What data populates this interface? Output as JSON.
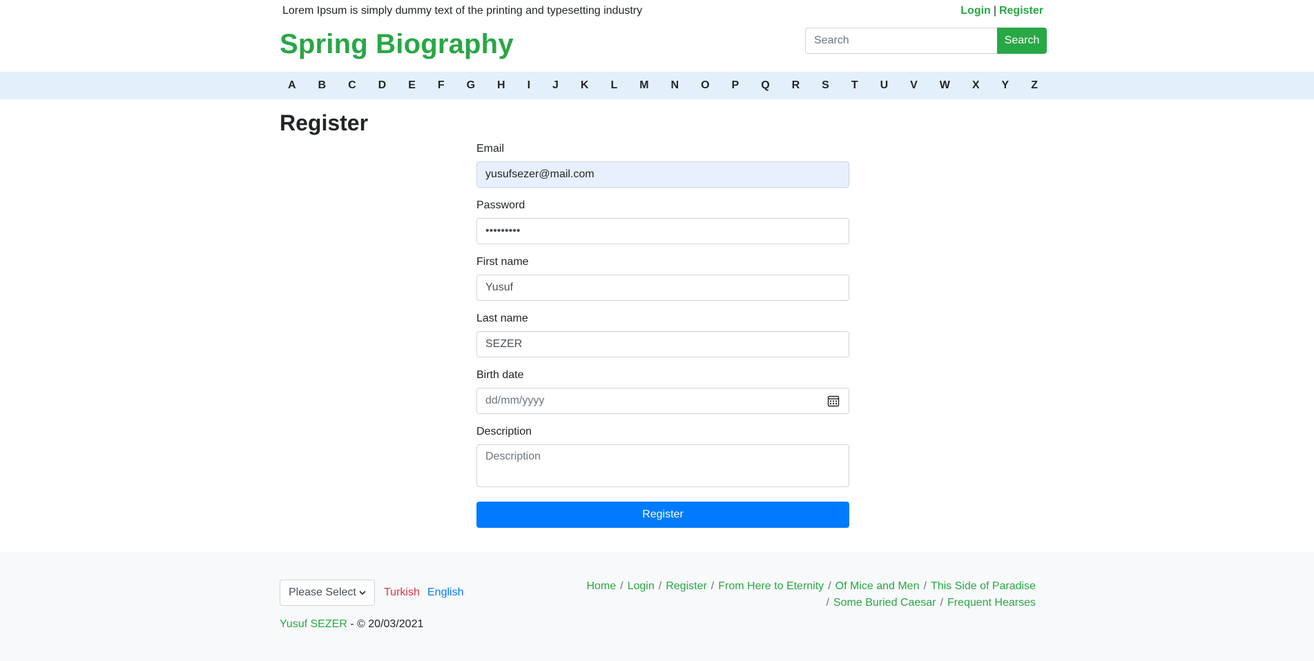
{
  "topbar": {
    "tagline": "Lorem Ipsum is simply dummy text of the printing and typesetting industry",
    "login": "Login",
    "separator": "|",
    "register": "Register"
  },
  "brand": "Spring Biography",
  "search": {
    "placeholder": "Search",
    "button": "Search"
  },
  "alphabet": [
    "A",
    "B",
    "C",
    "D",
    "E",
    "F",
    "G",
    "H",
    "I",
    "J",
    "K",
    "L",
    "M",
    "N",
    "O",
    "P",
    "Q",
    "R",
    "S",
    "T",
    "U",
    "V",
    "W",
    "X",
    "Y",
    "Z"
  ],
  "page_title": "Register",
  "form": {
    "email": {
      "label": "Email",
      "value": "yusufsezer@mail.com"
    },
    "password": {
      "label": "Password",
      "value": "•••••••••"
    },
    "first_name": {
      "label": "First name",
      "value": "Yusuf"
    },
    "last_name": {
      "label": "Last name",
      "value": "SEZER"
    },
    "birth_date": {
      "label": "Birth date",
      "placeholder": "dd/mm/yyyy"
    },
    "description": {
      "label": "Description",
      "placeholder": "Description"
    },
    "submit": "Register"
  },
  "footer": {
    "language_select": "Please Select",
    "turkish": "Turkish",
    "english": "English",
    "author": "Yusuf SEZER",
    "copyright": " - © 20/03/2021",
    "links_row1": [
      "Home",
      "Login",
      "Register",
      "From Here to Eternity",
      "Of Mice and Men",
      "This Side of Paradise"
    ],
    "links_row2": [
      "Some Buried Caesar",
      "Frequent Hearses"
    ]
  },
  "colors": {
    "brand_green": "#28a745",
    "primary_blue": "#007bff",
    "nav_bg": "#e3f0fc",
    "footer_bg": "#f8f9fa",
    "danger_red": "#dc3545"
  }
}
